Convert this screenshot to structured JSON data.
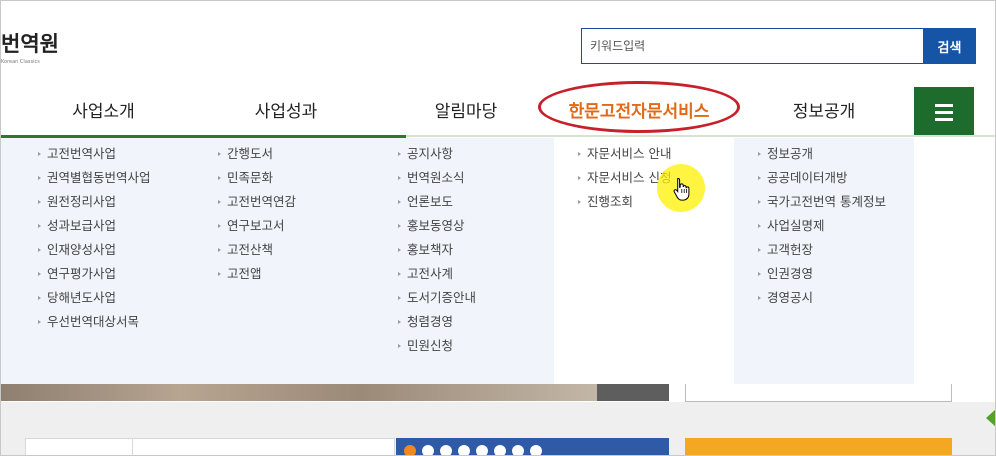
{
  "logo": {
    "text": "번역원",
    "sub": "Korean Classics"
  },
  "search": {
    "placeholder": "키워드입력",
    "button_label": "검색"
  },
  "nav": {
    "items": [
      {
        "label": "사업소개"
      },
      {
        "label": "사업성과"
      },
      {
        "label": "알림마당"
      },
      {
        "label": "한문고전자문서비스"
      },
      {
        "label": "정보공개"
      }
    ]
  },
  "dropdown": {
    "col1": [
      "고전번역사업",
      "권역별협동번역사업",
      "원전정리사업",
      "성과보급사업",
      "인재양성사업",
      "연구평가사업",
      "당해년도사업",
      "우선번역대상서목"
    ],
    "col2": [
      "간행도서",
      "민족문화",
      "고전번역연감",
      "연구보고서",
      "고전산책",
      "고전앱"
    ],
    "col3": [
      "공지사항",
      "번역원소식",
      "언론보도",
      "홍보동영상",
      "홍보책자",
      "고전사계",
      "도서기증안내",
      "청렴경영",
      "민원신청"
    ],
    "col4": [
      "자문서비스 안내",
      "자문서비스 신청",
      "진행조회"
    ],
    "col5": [
      "정보공개",
      "공공데이터개방",
      "국가고전번역 통계정보",
      "사업실명제",
      "고객헌장",
      "인권경영",
      "경영공시"
    ]
  },
  "colors": {
    "accent_nav": "#e06a18",
    "search_button": "#1654a5",
    "menu_button": "#1e6b2e",
    "highlight_ellipse": "#c8202a"
  },
  "icons": {
    "menu": "hamburger-icon",
    "cursor": "hand-pointer-icon"
  }
}
